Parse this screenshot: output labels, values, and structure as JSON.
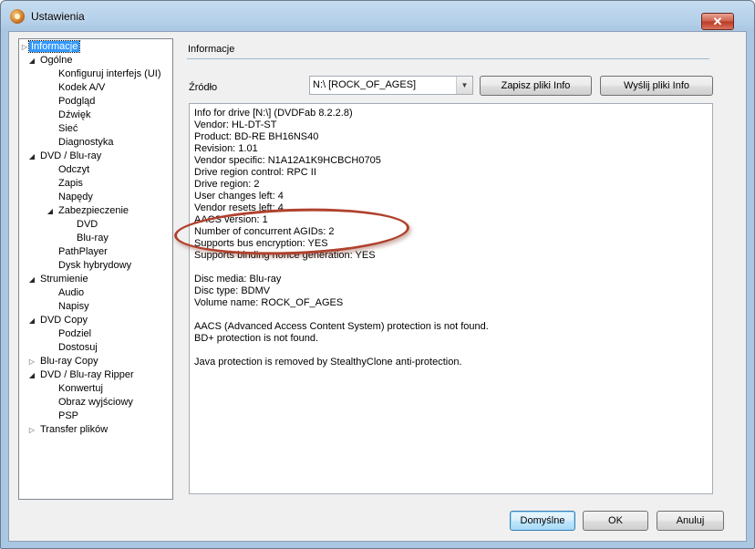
{
  "window": {
    "title": "Ustawienia",
    "close_symbol": "✕"
  },
  "tree": {
    "items": [
      {
        "label": "Informacje",
        "selected": true
      },
      {
        "label": "Ogólne"
      },
      {
        "label": "Konfiguruj interfejs (UI)"
      },
      {
        "label": "Kodek A/V"
      },
      {
        "label": "Podgląd"
      },
      {
        "label": "Dźwięk"
      },
      {
        "label": "Sieć"
      },
      {
        "label": "Diagnostyka"
      },
      {
        "label": "DVD / Blu-ray"
      },
      {
        "label": "Odczyt"
      },
      {
        "label": "Zapis"
      },
      {
        "label": "Napędy"
      },
      {
        "label": "Zabezpieczenie"
      },
      {
        "label": "DVD"
      },
      {
        "label": "Blu-ray"
      },
      {
        "label": "PathPlayer"
      },
      {
        "label": "Dysk hybrydowy"
      },
      {
        "label": "Strumienie"
      },
      {
        "label": "Audio"
      },
      {
        "label": "Napisy"
      },
      {
        "label": "DVD Copy"
      },
      {
        "label": "Podziel"
      },
      {
        "label": "Dostosuj"
      },
      {
        "label": "Blu-ray Copy"
      },
      {
        "label": "DVD / Blu-ray Ripper"
      },
      {
        "label": "Konwertuj"
      },
      {
        "label": "Obraz wyjściowy"
      },
      {
        "label": "PSP"
      },
      {
        "label": "Transfer plików"
      }
    ]
  },
  "panel": {
    "section_title": "Informacje",
    "source_label": "Źródło",
    "source_value": "N:\\ [ROCK_OF_AGES]",
    "save_info_label": "Zapisz pliki Info",
    "send_info_label": "Wyślij pliki Info",
    "info_lines": [
      "Info for drive [N:\\] (DVDFab 8.2.2.8)",
      "Vendor: HL-DT-ST",
      "Product: BD-RE  BH16NS40",
      "Revision: 1.01",
      "Vendor specific: N1A12A1K9HCBCH0705",
      "Drive region control: RPC II",
      "Drive region: 2",
      "User changes left: 4",
      "Vendor resets left: 4",
      "AACS version: 1",
      "Number of concurrent AGIDs: 2",
      "Supports bus encryption: YES",
      "Supports binding nonce generation: YES",
      "",
      "Disc media: Blu-ray",
      "Disc type: BDMV",
      "Volume name: ROCK_OF_AGES",
      "",
      "AACS (Advanced Access Content System) protection is not found.",
      "BD+ protection is not found.",
      "",
      "Java protection is removed by StealthyClone anti-protection."
    ]
  },
  "footer": {
    "defaults_label": "Domyślne",
    "ok_label": "OK",
    "cancel_label": "Anuluj"
  },
  "colors": {
    "selection": "#3399ff",
    "annotation": "#b0412d"
  }
}
